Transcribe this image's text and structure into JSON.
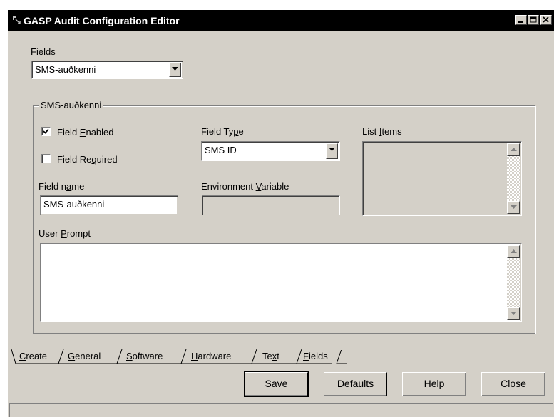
{
  "window": {
    "title": "GASP Audit Configuration Editor"
  },
  "fields_selector": {
    "label_pre": "Fi",
    "label_mnemonic": "e",
    "label_post": "lds",
    "selected": "SMS-auðkenni"
  },
  "group": {
    "title": "SMS-auðkenni",
    "field_enabled": {
      "pre": "Field ",
      "mn": "E",
      "post": "nabled",
      "checked": true
    },
    "field_required": {
      "pre": "Field Re",
      "mn": "q",
      "post": "uired",
      "checked": false
    },
    "field_name": {
      "pre": "Field n",
      "mn": "a",
      "post": "me",
      "value": "SMS-auðkenni"
    },
    "field_type": {
      "pre": "Field Ty",
      "mn": "p",
      "post": "e",
      "selected": "SMS ID"
    },
    "env_var": {
      "pre": "Environment ",
      "mn": "V",
      "post": "ariable",
      "value": ""
    },
    "list_items": {
      "pre": "List ",
      "mn": "I",
      "post": "tems"
    },
    "user_prompt": {
      "pre": "User ",
      "mn": "P",
      "post": "rompt",
      "value": ""
    }
  },
  "tabs": [
    {
      "pre": "",
      "mn": "C",
      "post": "reate"
    },
    {
      "pre": "",
      "mn": "G",
      "post": "eneral"
    },
    {
      "pre": "",
      "mn": "S",
      "post": "oftware"
    },
    {
      "pre": "",
      "mn": "H",
      "post": "ardware"
    },
    {
      "pre": "Te",
      "mn": "x",
      "post": "t"
    },
    {
      "pre": "",
      "mn": "F",
      "post": "ields"
    }
  ],
  "buttons": {
    "save": "Save",
    "defaults": "Defaults",
    "help": "Help",
    "close": "Close"
  },
  "icons": {
    "app": "gasp-app-icon",
    "minimize": "minimize-icon",
    "maximize": "maximize-icon",
    "close": "close-icon",
    "dropdown": "chevron-down-icon",
    "checkmark": "checkmark-icon",
    "scroll_up": "scroll-up-icon",
    "scroll_down": "scroll-down-icon"
  }
}
